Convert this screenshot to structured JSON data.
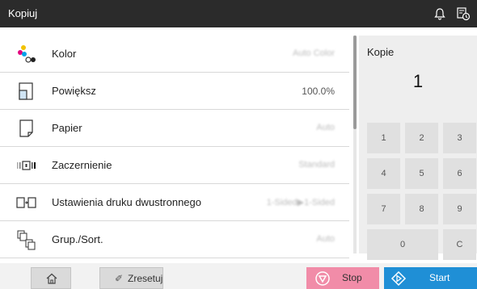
{
  "header": {
    "title": "Kopiuj"
  },
  "icons": {
    "notification": "bell-icon",
    "job_status": "job-status-icon"
  },
  "settings": [
    {
      "label": "Kolor",
      "value": "Auto Color",
      "value_obscured": true,
      "icon": "color-dots-icon"
    },
    {
      "label": "Powiększ",
      "value": "100.0%",
      "value_obscured": false,
      "icon": "zoom-page-icon"
    },
    {
      "label": "Papier",
      "value": "Auto",
      "value_obscured": true,
      "icon": "paper-icon"
    },
    {
      "label": "Zaczernienie",
      "value": "Standard",
      "value_obscured": true,
      "icon": "density-icon"
    },
    {
      "label": "Ustawienia druku dwustronnego",
      "value": "1-Sided▶1-Sided",
      "value_obscured": true,
      "icon": "duplex-icon"
    },
    {
      "label": "Grup./Sort.",
      "value": "Auto",
      "value_obscured": true,
      "icon": "sort-icon"
    }
  ],
  "copies": {
    "label": "Kopie",
    "value": "1"
  },
  "keypad": [
    "1",
    "2",
    "3",
    "4",
    "5",
    "6",
    "7",
    "8",
    "9",
    "0",
    "C"
  ],
  "bottom": {
    "reset_label": "Zresetuj",
    "stop_label": "Stop",
    "start_label": "Start"
  },
  "colors": {
    "stop": "#f18ca8",
    "start": "#1f8fd6",
    "titlebar": "#2b2b2b"
  }
}
